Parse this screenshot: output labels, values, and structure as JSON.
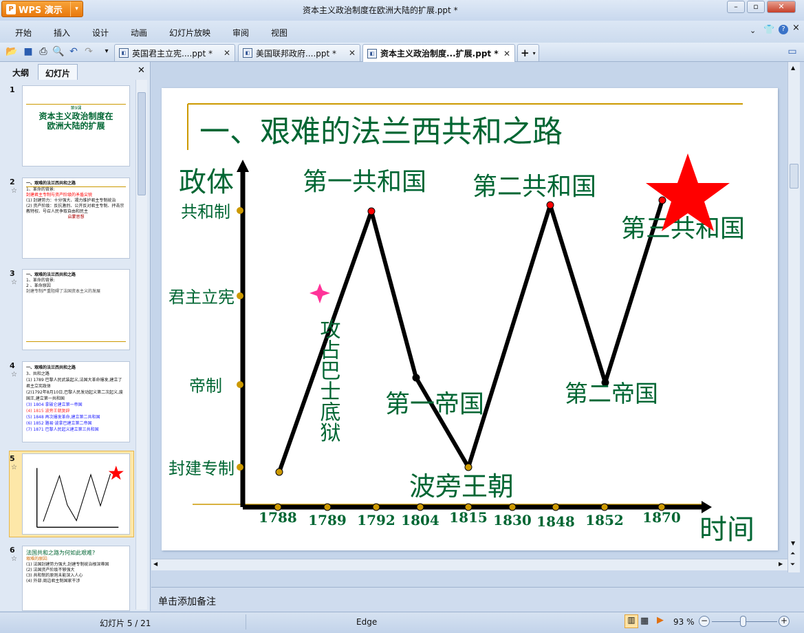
{
  "app": {
    "name": "WPS 演示",
    "doc_title": "资本主义政治制度在欧洲大陆的扩展.ppt *"
  },
  "menu": [
    "开始",
    "插入",
    "设计",
    "动画",
    "幻灯片放映",
    "审阅",
    "视图"
  ],
  "tabs": [
    {
      "label": "英国君主立宪....ppt *"
    },
    {
      "label": "美国联邦政府....ppt *"
    },
    {
      "label": "资本主义政治制度...扩展.ppt *"
    }
  ],
  "panel": {
    "tab_outline": "大纲",
    "tab_slides": "幻灯片"
  },
  "thumbnails": [
    {
      "num": "1",
      "lines": [
        "第9课",
        "资本主义政治制度在",
        "欧洲大陆的扩展"
      ]
    },
    {
      "num": "2",
      "lines": [
        "一、艰难的法兰西共和之路",
        "1、革命的背景:",
        "封建君主专制与资产阶级的矛盾尖锐",
        "(1) 封建势力：十分强大、竭力维护君主专制统治",
        "(2) 资产阶级：反抗激烈、公开反对君主专制、抨击宗教特权、号召人民争取自由和民主",
        "启蒙思想"
      ]
    },
    {
      "num": "3",
      "lines": [
        "一、艰难的法兰西共和之路",
        "1、革命的背景:",
        "2 、革命原因",
        "封建专制严重阻碍了法国资本主义的发展"
      ]
    },
    {
      "num": "4",
      "lines": [
        "一、艰难的法兰西共和之路",
        "3、共和之路",
        "(1) 1789 巴黎人民武装起义,法国大革命爆发,建立了君主立宪政体",
        "(2)1792年8月10日,巴黎人民发动起义第二次起义,废国王,建立第一共和国",
        "(3) 1804 拿破仑建立第一帝国",
        "(4) 1815 波旁王朝复辟",
        "(5) 1848 再次爆发革命,建立第二共和国",
        "(6) 1852 路易·波拿巴建立第二帝国",
        "(7) 1871 巴黎人民起义建立第三共和国"
      ]
    },
    {
      "num": "5",
      "lines": []
    },
    {
      "num": "6",
      "lines": [
        "法国共和之路为何如此艰难?",
        "艰难的原因:",
        "(1) 法国封建势力强大,封建专制统治根深蒂固",
        "(2) 法国资产阶级不够强大",
        "(3) 共和制的原则未能深入人心",
        "(4) 外部:周边君主制国家干涉"
      ]
    }
  ],
  "slide": {
    "title": "一、艰难的法兰西共和之路",
    "y_axis_title": "政体",
    "x_axis_title": "时间",
    "y_levels": [
      "共和制",
      "君主立宪",
      "帝制",
      "封建专制"
    ],
    "years": [
      "1788",
      "1789",
      "1792",
      "1804",
      "1815",
      "1830",
      "1848",
      "1852",
      "1870"
    ],
    "labels": {
      "r1": "第一共和国",
      "r2": "第二共和国",
      "r3": "第三共和国",
      "e1": "第一帝国",
      "e2": "第二帝国",
      "bourbon": "波旁王朝",
      "bastille": "攻占巴士底狱"
    },
    "colors": {
      "title": "#006633",
      "line": "#000000",
      "dot_red": "#ff0000",
      "dot_gold": "#cc9900",
      "star": "#ff0000",
      "spark": "#ff3399"
    }
  },
  "notes": {
    "placeholder": "单击添加备注"
  },
  "status": {
    "slide": "幻灯片 5 / 21",
    "theme": "Edge",
    "zoom": "93 %",
    "zoom_percent": 93
  }
}
